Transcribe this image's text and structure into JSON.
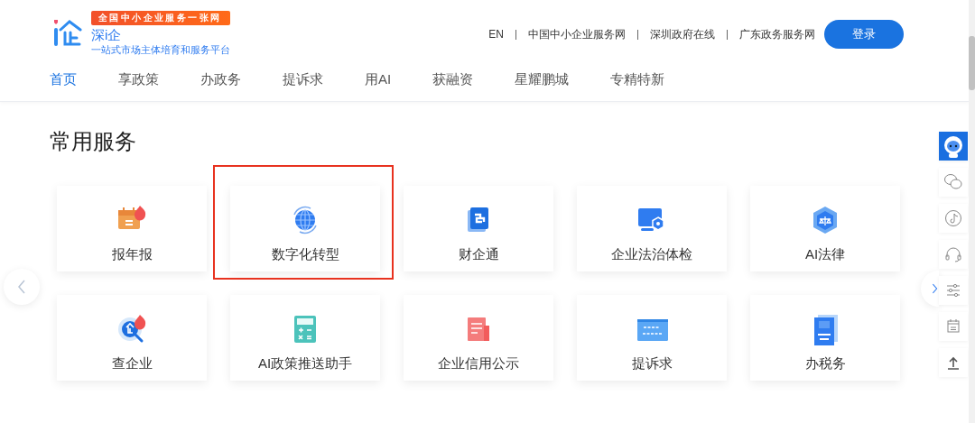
{
  "header": {
    "badge": "全国中小企业服务一张网",
    "brand": "深i企",
    "slogan": "一站式市场主体培育和服务平台",
    "links": [
      "EN",
      "中国中小企业服务网",
      "深圳政府在线",
      "广东政务服务网"
    ],
    "login_button": "登录"
  },
  "nav": [
    {
      "label": "首页",
      "selected": true
    },
    {
      "label": "享政策",
      "selected": false
    },
    {
      "label": "办政务",
      "selected": false
    },
    {
      "label": "提诉求",
      "selected": false
    },
    {
      "label": "用AI",
      "selected": false
    },
    {
      "label": "获融资",
      "selected": false
    },
    {
      "label": "星耀鹏城",
      "selected": false
    },
    {
      "label": "专精特新",
      "selected": false
    }
  ],
  "section": {
    "title": "常用服务",
    "cards": [
      {
        "label": "报年报",
        "kind": "calendar",
        "hot": true,
        "highlighted": false
      },
      {
        "label": "数字化转型",
        "kind": "globe",
        "hot": false,
        "highlighted": true
      },
      {
        "label": "财企通",
        "kind": "document",
        "hot": false,
        "highlighted": false
      },
      {
        "label": "企业法治体检",
        "kind": "monitor",
        "hot": false,
        "highlighted": false
      },
      {
        "label": "AI法律",
        "kind": "shield",
        "hot": false,
        "highlighted": false
      },
      {
        "label": "查企业",
        "kind": "search",
        "hot": true,
        "highlighted": false
      },
      {
        "label": "AI政策推送助手",
        "kind": "calculator",
        "hot": false,
        "highlighted": false
      },
      {
        "label": "企业信用公示",
        "kind": "report",
        "hot": false,
        "highlighted": false
      },
      {
        "label": "提诉求",
        "kind": "banner",
        "hot": false,
        "highlighted": false
      },
      {
        "label": "办税务",
        "kind": "book",
        "hot": false,
        "highlighted": false
      }
    ]
  },
  "side_toolbar": [
    {
      "kind": "robot"
    },
    {
      "kind": "chat"
    },
    {
      "kind": "music"
    },
    {
      "kind": "headset"
    },
    {
      "kind": "sliders"
    },
    {
      "kind": "calendar"
    },
    {
      "kind": "upload"
    }
  ]
}
